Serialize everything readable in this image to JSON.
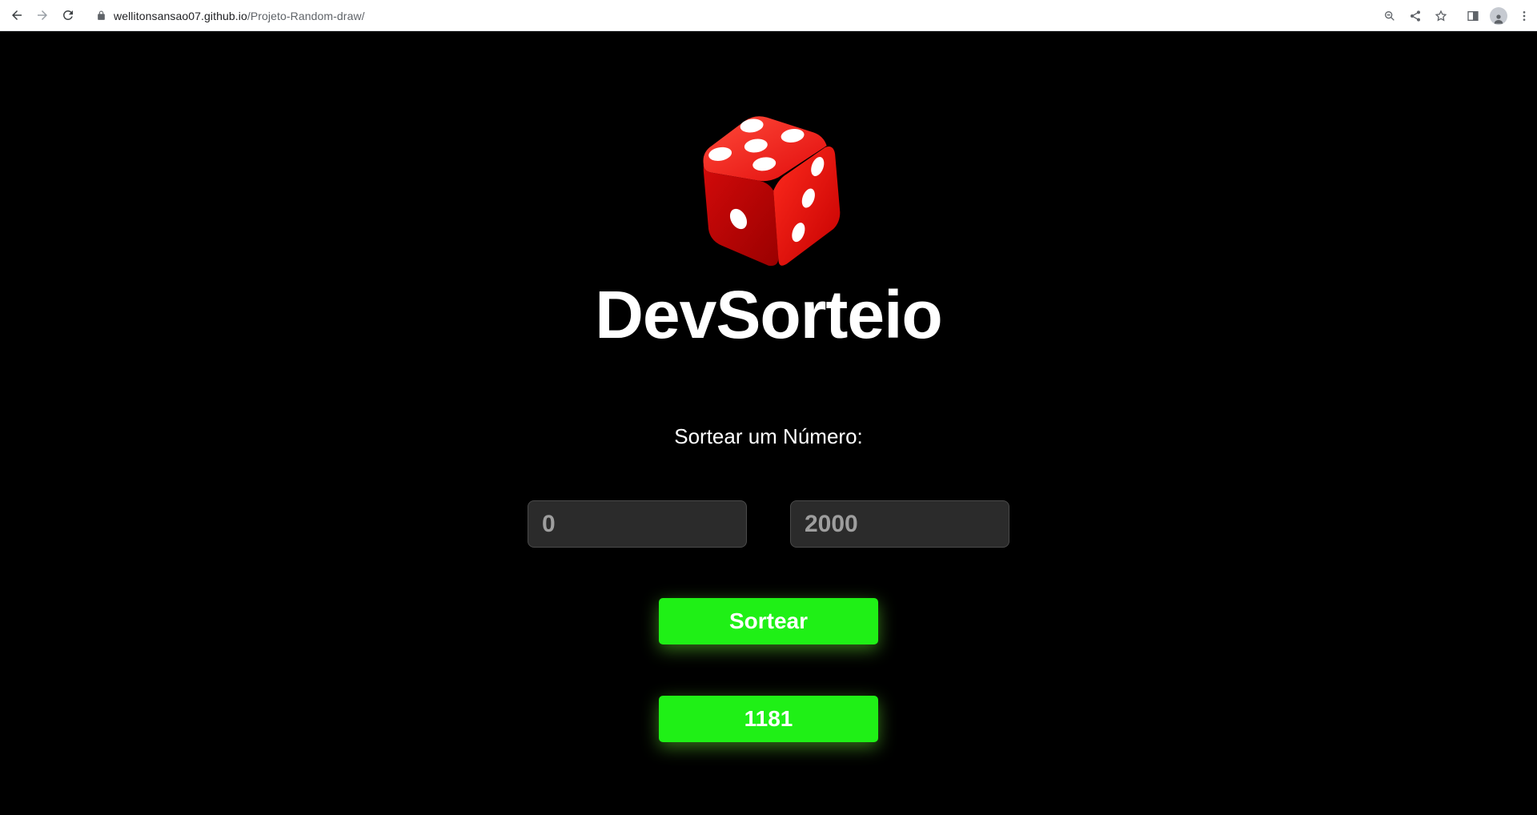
{
  "browser": {
    "url_host": "wellitonsansao07.github.io",
    "url_path": "/Projeto-Random-draw/"
  },
  "app": {
    "title": "DevSorteio",
    "subtitle": "Sortear um Número:",
    "min_placeholder": "0",
    "max_placeholder": "2000",
    "draw_button": "Sortear",
    "result": "1181"
  },
  "colors": {
    "accent": "#1ff016",
    "background": "#000000",
    "dice": "#e00000"
  }
}
